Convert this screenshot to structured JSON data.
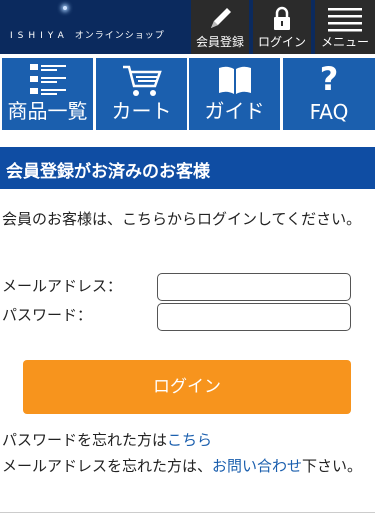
{
  "header": {
    "brand": "ISHIYA",
    "brand_sub": "オンラインショップ",
    "buttons": [
      {
        "label": "会員登録",
        "icon": "pencil-icon"
      },
      {
        "label": "ログイン",
        "icon": "lock-icon"
      },
      {
        "label": "メニュー",
        "icon": "hamburger-icon"
      }
    ]
  },
  "nav": {
    "tiles": [
      {
        "label": "商品一覧",
        "icon": "list-icon"
      },
      {
        "label": "カート",
        "icon": "cart-icon"
      },
      {
        "label": "ガイド",
        "icon": "book-icon"
      },
      {
        "label": "FAQ",
        "icon": "question-icon",
        "glyph": "?"
      }
    ]
  },
  "section": {
    "title": "会員登録がお済みのお客様",
    "intro": "会員のお客様は、こちらからログインしてください。"
  },
  "form": {
    "email_label": "メールアドレス：",
    "password_label": "パスワード：",
    "email_value": "",
    "password_value": "",
    "submit_label": "ログイン"
  },
  "help": {
    "forgot_password_text": "パスワードを忘れた方は",
    "forgot_password_link": "こちら",
    "forgot_email_text": "メールアドレスを忘れた方は、",
    "forgot_email_link": "お問い合わせ",
    "forgot_email_suffix": "下さい。"
  },
  "colors": {
    "header_bg": "#0b2a5e",
    "tile_bg": "#1b5fae",
    "section_bg": "#0f4da3",
    "button_bg": "#f7941d",
    "link": "#1b5fae"
  }
}
